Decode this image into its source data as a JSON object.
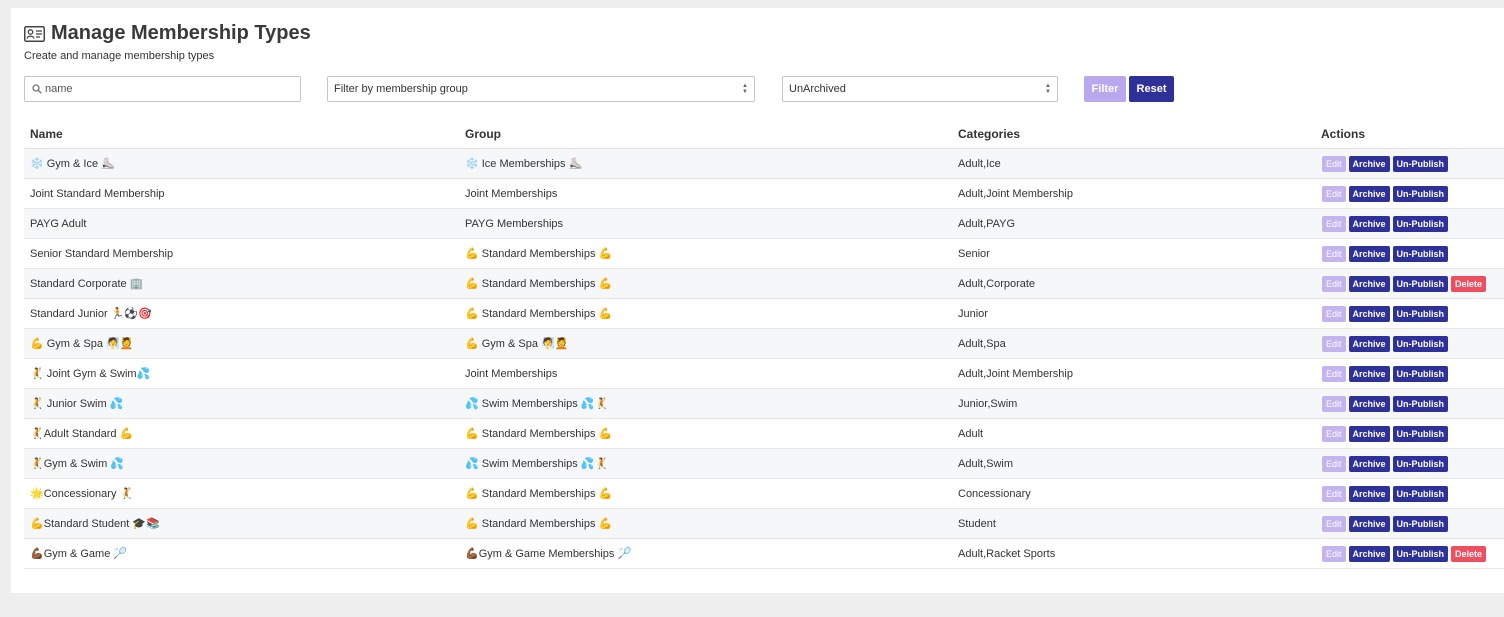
{
  "header": {
    "title": "Manage Membership Types",
    "subtitle": "Create and manage membership types",
    "title_icon": "id-card-icon"
  },
  "filters": {
    "search_placeholder": "name",
    "search_value": "",
    "group_select": "Filter by membership group",
    "archive_select": "UnArchived",
    "filter_label": "Filter",
    "reset_label": "Reset"
  },
  "table": {
    "columns": [
      "Name",
      "Group",
      "Categories",
      "Actions"
    ],
    "action_labels": {
      "edit": "Edit",
      "archive": "Archive",
      "unpublish": "Un-Publish",
      "delete": "Delete"
    },
    "rows": [
      {
        "name": "❄️ Gym & Ice ⛸️",
        "group": "❄️ Ice Memberships ⛸️",
        "categories": "Adult,Ice",
        "delete": false
      },
      {
        "name": "Joint Standard Membership",
        "group": "Joint Memberships",
        "categories": "Adult,Joint Membership",
        "delete": false
      },
      {
        "name": "PAYG Adult",
        "group": "PAYG Memberships",
        "categories": "Adult,PAYG",
        "delete": false
      },
      {
        "name": "Senior Standard Membership",
        "group": "💪 Standard Memberships 💪",
        "categories": "Senior",
        "delete": false
      },
      {
        "name": "Standard Corporate 🏢",
        "group": "💪 Standard Memberships 💪",
        "categories": "Adult,Corporate",
        "delete": true
      },
      {
        "name": "Standard Junior 🏃⚽🎯",
        "group": "💪 Standard Memberships 💪",
        "categories": "Junior",
        "delete": false
      },
      {
        "name": "💪 Gym & Spa 🧖💆",
        "group": "💪 Gym & Spa 🧖💆",
        "categories": "Adult,Spa",
        "delete": false
      },
      {
        "name": "🤾 Joint Gym & Swim💦",
        "group": "Joint Memberships",
        "categories": "Adult,Joint Membership",
        "delete": false
      },
      {
        "name": "🤾 Junior Swim 💦",
        "group": "💦 Swim Memberships 💦🤾",
        "categories": "Junior,Swim",
        "delete": false
      },
      {
        "name": "🤾Adult Standard 💪",
        "group": "💪 Standard Memberships 💪",
        "categories": "Adult",
        "delete": false
      },
      {
        "name": "🤾Gym & Swim 💦",
        "group": "💦 Swim Memberships 💦🤾",
        "categories": "Adult,Swim",
        "delete": false
      },
      {
        "name": "🌟Concessionary 🤾",
        "group": "💪 Standard Memberships 💪",
        "categories": "Concessionary",
        "delete": false
      },
      {
        "name": "💪Standard Student 🎓📚",
        "group": "💪 Standard Memberships 💪",
        "categories": "Student",
        "delete": false
      },
      {
        "name": "💪🏾Gym & Game 🏸",
        "group": "💪🏾Gym & Game Memberships 🏸",
        "categories": "Adult,Racket Sports",
        "delete": true
      }
    ]
  },
  "colors": {
    "primary": "#2f319a",
    "filter_button": "#b9a8ee",
    "edit_button": "#c3b3ef",
    "delete_button": "#f04e5e"
  }
}
